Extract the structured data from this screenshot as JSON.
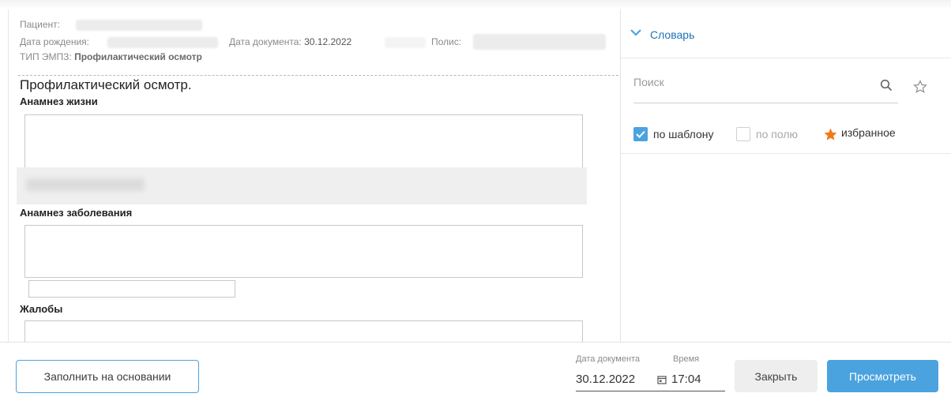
{
  "header": {
    "patient_label": "Пациент:",
    "birth_label": "Дата рождения:",
    "doc_date_label": "Дата документа:",
    "doc_date_value": "30.12.2022",
    "policy_label": "Полис:",
    "type_label": "ТИП ЭМПЗ:",
    "type_value": "Профилактический осмотр"
  },
  "document": {
    "title": "Профилактический осмотр.",
    "sections": [
      {
        "label": "Анамнез жизни"
      },
      {
        "label": "Анамнез заболевания"
      },
      {
        "label": "Жалобы"
      }
    ]
  },
  "dictionary": {
    "title": "Словарь",
    "search_placeholder": "Поиск",
    "filters": {
      "by_template": "по шаблону",
      "by_field": "по полю",
      "favorites": "избранное"
    },
    "by_template_checked": true,
    "by_field_checked": false
  },
  "footer": {
    "fill_button": "Заполнить на основании",
    "date_label": "Дата документа",
    "date_value": "30.12.2022",
    "time_label": "Время",
    "time_value": "17:04",
    "close_button": "Закрыть",
    "view_button": "Просмотреть"
  },
  "colors": {
    "accent": "#4aa3df",
    "link": "#1e73b9",
    "favorite_star": "#f07a1a"
  },
  "icons": [
    "chevron-down-icon",
    "search-icon",
    "star-outline-icon",
    "star-filled-icon",
    "calendar-icon"
  ]
}
